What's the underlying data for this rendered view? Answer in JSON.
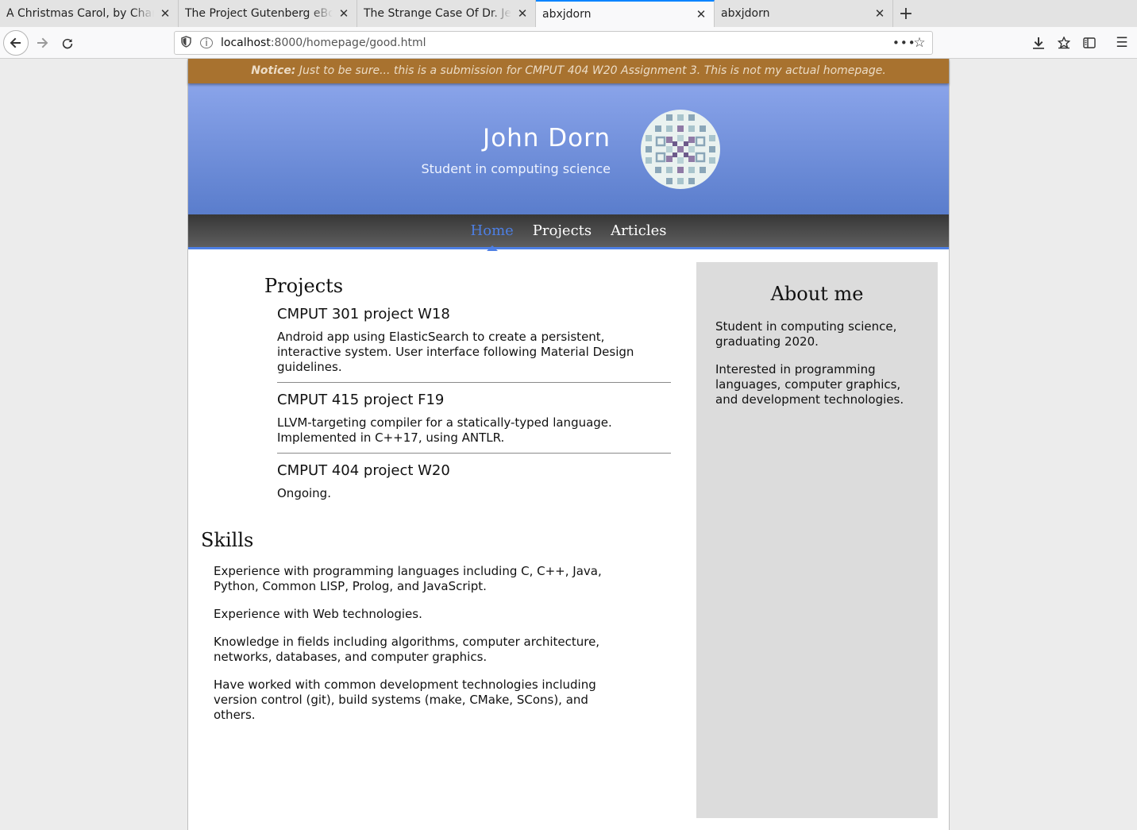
{
  "browser": {
    "tabs": [
      {
        "title": "A Christmas Carol, by Charles Dickens",
        "active": false
      },
      {
        "title": "The Project Gutenberg eBook",
        "active": false
      },
      {
        "title": "The Strange Case Of Dr. Jekyll",
        "active": false
      },
      {
        "title": "abxjdorn",
        "active": true
      },
      {
        "title": "abxjdorn",
        "active": false
      }
    ],
    "url_host": "localhost",
    "url_rest": ":8000/homepage/good.html"
  },
  "page": {
    "notice_label": "Notice:",
    "notice_text": " Just to be sure... this is a submission for CMPUT 404 W20 Assignment 3. This is not my actual homepage.",
    "name": "John Dorn",
    "subtitle": "Student in computing science",
    "nav": [
      {
        "label": "Home",
        "active": true
      },
      {
        "label": "Projects",
        "active": false
      },
      {
        "label": "Articles",
        "active": false
      }
    ],
    "projects_heading": "Projects",
    "projects": [
      {
        "title": "CMPUT 301 project W18",
        "description": "Android app using ElasticSearch to create a persistent, interactive system. User interface following Material Design guidelines."
      },
      {
        "title": "CMPUT 415 project F19",
        "description": "LLVM-targeting compiler for a statically-typed language. Implemented in C++17, using ANTLR."
      },
      {
        "title": "CMPUT 404 project W20",
        "description": "Ongoing."
      }
    ],
    "skills_heading": "Skills",
    "skills": [
      "Experience with programming languages including C, C++, Java, Python, Common LISP, Prolog, and JavaScript.",
      "Experience with Web technologies.",
      "Knowledge in fields including algorithms, computer architecture, networks, databases, and computer graphics.",
      "Have worked with common development technologies including version control (git), build systems (make, CMake, SCons), and others."
    ],
    "about_heading": "About me",
    "about": [
      "Student in computing science, graduating 2020.",
      "Interested in programming languages, computer graphics, and development technologies."
    ]
  },
  "colors": {
    "notice_bg": "#a8722f",
    "banner_top": "#8aa4ea",
    "banner_bottom": "#5a7dcc",
    "nav_accent": "#4d7fe4",
    "sidebar_bg": "#dcdcdc"
  },
  "icons": {
    "back": "back-arrow-icon",
    "forward": "forward-arrow-icon",
    "reload": "reload-icon",
    "shield": "tracking-shield-icon",
    "info": "site-info-icon",
    "more": "page-actions-icon",
    "bookmark": "bookmark-star-icon",
    "downloads": "download-icon",
    "library": "library-icon",
    "sidebar": "sidebar-icon",
    "menu": "hamburger-menu-icon",
    "close": "close-icon",
    "new_tab": "plus-icon"
  }
}
